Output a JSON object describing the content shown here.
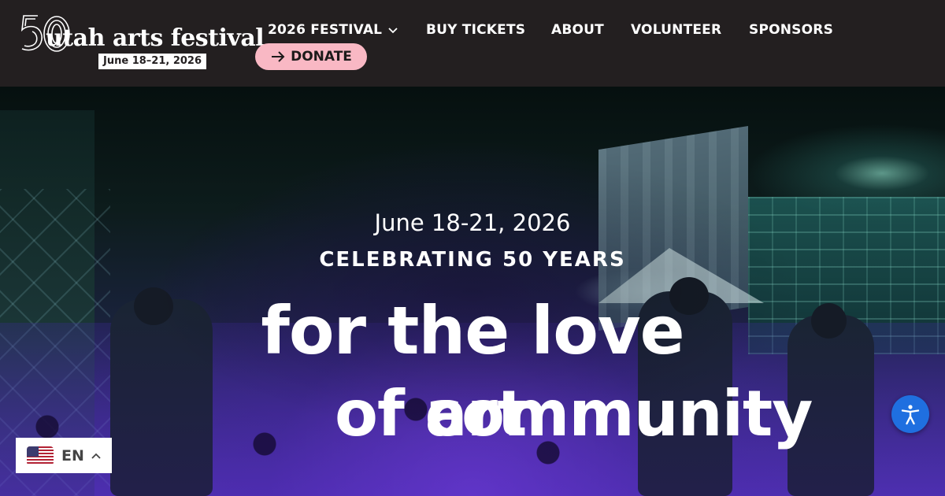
{
  "header": {
    "logo": {
      "number": "50",
      "name": "utah arts festival",
      "date": "June 18–21, 2026"
    },
    "nav": [
      {
        "label": "2026 FESTIVAL",
        "icon": "chevron-down-icon"
      },
      {
        "label": "BUY TICKETS"
      },
      {
        "label": "ABOUT"
      },
      {
        "label": "VOLUNTEER"
      },
      {
        "label": "SPONSORS"
      }
    ],
    "donate": {
      "label": "DONATE",
      "icon": "arrow-right-icon",
      "color": "#f9b8c4"
    }
  },
  "hero": {
    "date": "June 18-21, 2026",
    "subtitle": "CELEBRATING 50 YEARS",
    "line1": "for the love",
    "line2_prefix": "of",
    "rotating_words": [
      "art",
      "community"
    ]
  },
  "language": {
    "code": "EN",
    "icon": "us-flag-icon"
  },
  "accessibility": {
    "icon": "accessibility-icon",
    "color": "#1f6fe0"
  },
  "colors": {
    "header_bg": "#231f20",
    "accent_pink": "#f9b8c4"
  }
}
